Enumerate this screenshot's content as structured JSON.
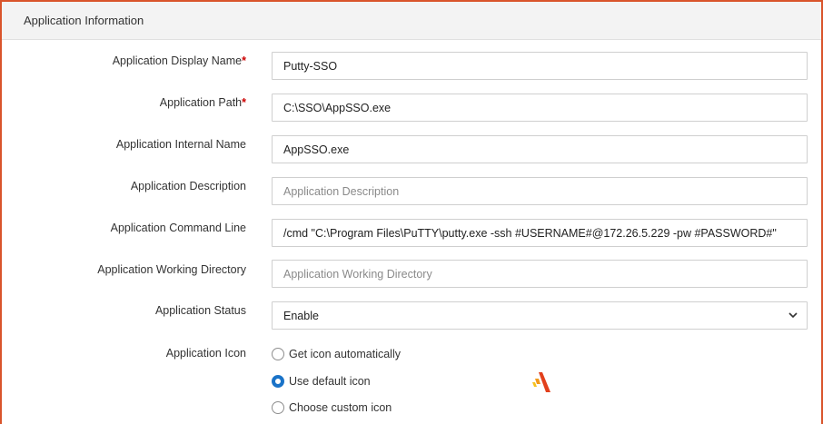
{
  "section": {
    "title": "Application Information"
  },
  "fields": {
    "display_name": {
      "label": "Application Display Name",
      "required": "*",
      "value": "Putty-SSO"
    },
    "path": {
      "label": "Application Path",
      "required": "*",
      "value": "C:\\SSO\\AppSSO.exe"
    },
    "internal_name": {
      "label": "Application Internal Name",
      "value": "AppSSO.exe"
    },
    "description": {
      "label": "Application Description",
      "placeholder": "Application Description"
    },
    "command_line": {
      "label": "Application Command Line",
      "value": "/cmd \"C:\\Program Files\\PuTTY\\putty.exe -ssh #USERNAME#@172.26.5.229 -pw #PASSWORD#\""
    },
    "working_dir": {
      "label": "Application Working Directory",
      "placeholder": "Application Working Directory"
    },
    "status": {
      "label": "Application Status",
      "value": "Enable"
    },
    "icon": {
      "label": "Application Icon",
      "options": [
        {
          "label": "Get icon automatically",
          "checked": false
        },
        {
          "label": "Use default icon",
          "checked": true
        },
        {
          "label": "Choose custom icon",
          "checked": false
        }
      ]
    }
  },
  "colors": {
    "accent": "#1a73c8",
    "border": "#d9542b",
    "required": "#cc0000"
  },
  "icons": {
    "status_dropdown": "chevron-down-icon",
    "default_icon_preview": "app-logo-icon"
  }
}
